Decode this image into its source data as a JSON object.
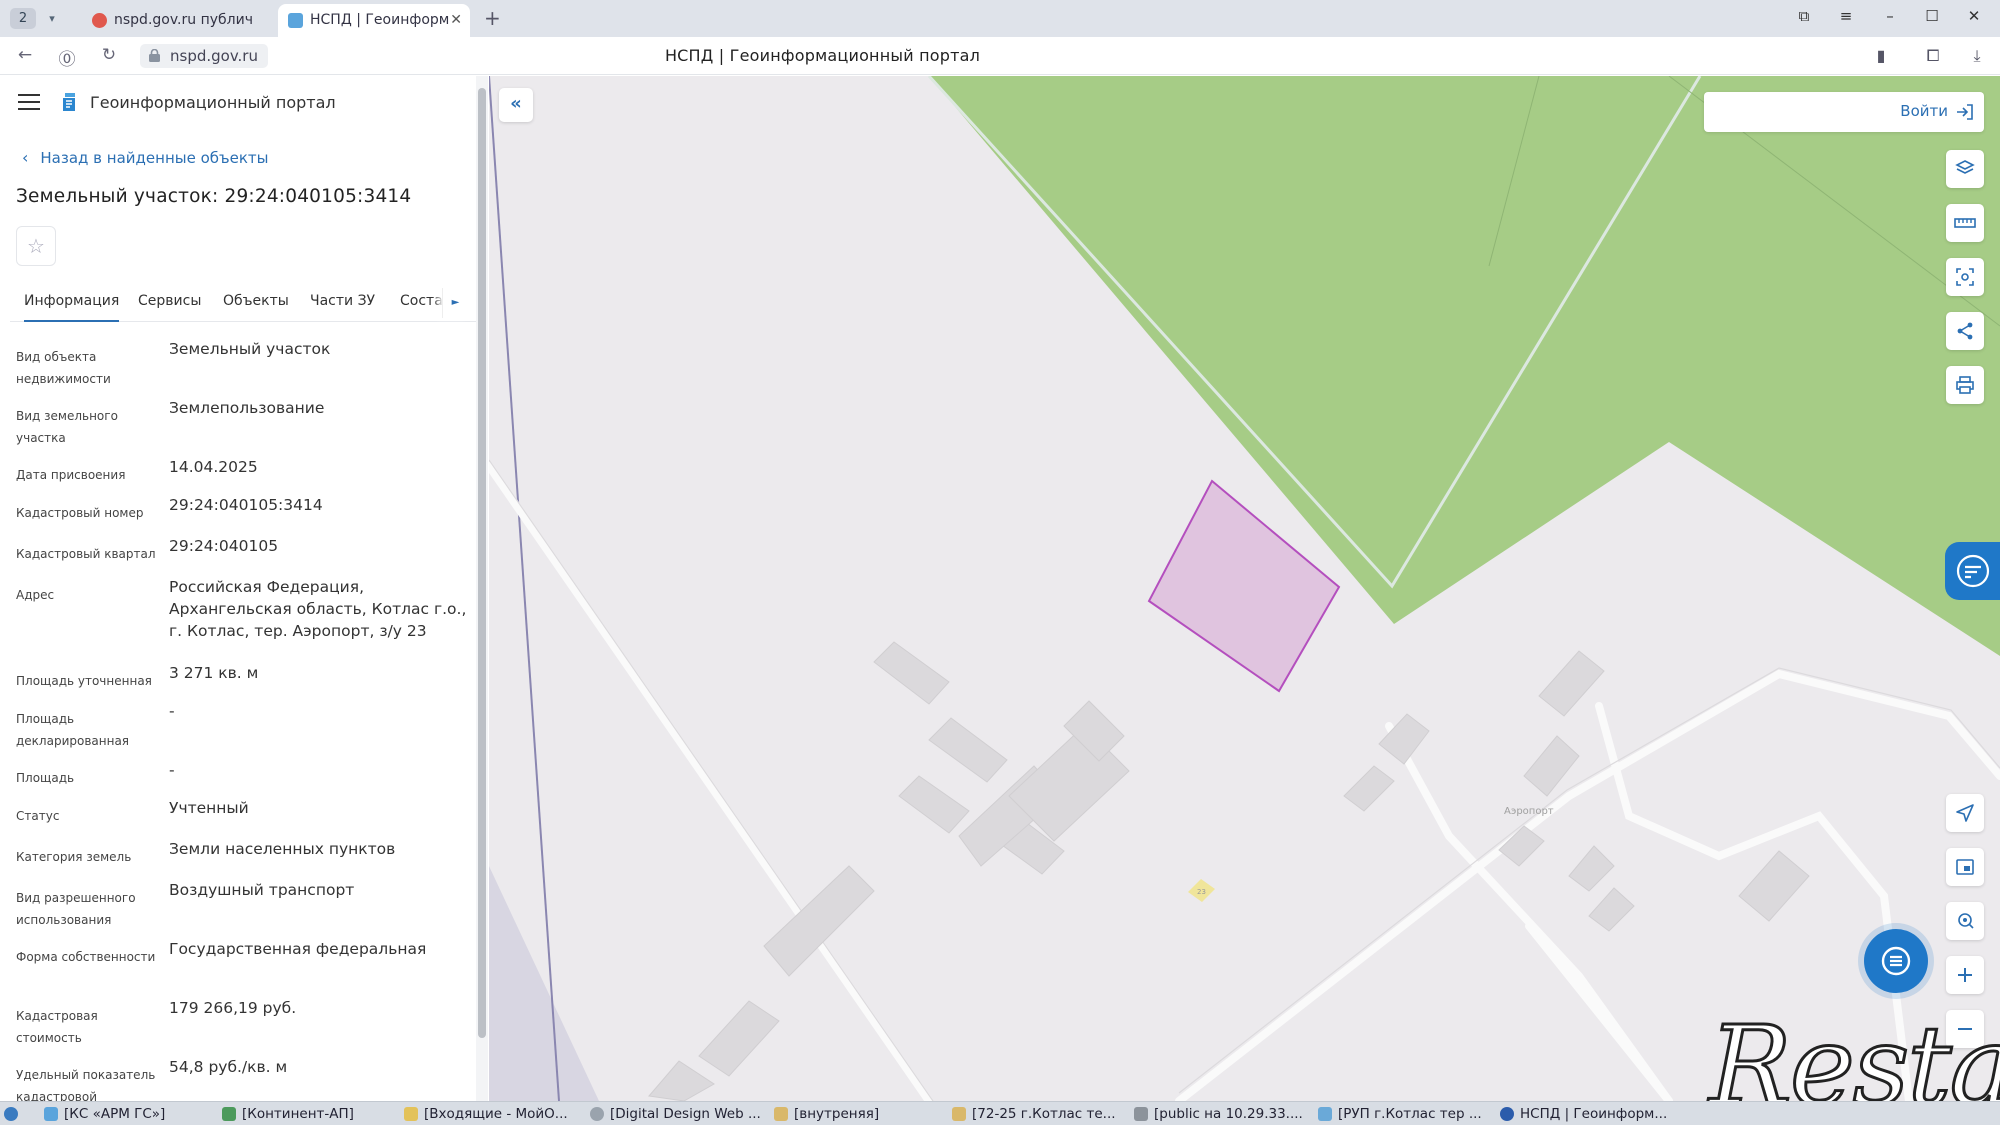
{
  "browser": {
    "tab_count": "2",
    "tabs": [
      {
        "label": "nspd.gov.ru публичная"
      },
      {
        "label": "НСПД | Геоинформа"
      }
    ],
    "url": "nspd.gov.ru",
    "page_title": "НСПД | Геоинформационный портал"
  },
  "panel": {
    "portal_name": "Геоинформационный портал",
    "back_link": "Назад в найденные объекты",
    "title": "Земельный участок: 29:24:040105:3414",
    "tabs": [
      {
        "label": "Информация"
      },
      {
        "label": "Сервисы"
      },
      {
        "label": "Объекты"
      },
      {
        "label": "Части ЗУ"
      },
      {
        "label": "Соста"
      }
    ],
    "rows": [
      {
        "label": "Вид объекта недвижимости",
        "value": "Земельный участок"
      },
      {
        "label": "Вид земельного участка",
        "value": "Землепользование"
      },
      {
        "label": "Дата присвоения",
        "value": "14.04.2025"
      },
      {
        "label": "Кадастровый номер",
        "value": "29:24:040105:3414"
      },
      {
        "label": "Кадастровый квартал",
        "value": "29:24:040105"
      },
      {
        "label": "Адрес",
        "value": "Российская Федерация, Архангельская область, Котлас г.о., г. Котлас, тер. Аэропорт, з/у 23"
      },
      {
        "label": "Площадь уточненная",
        "value": "3 271 кв. м"
      },
      {
        "label": "Площадь декларированная",
        "value": "-"
      },
      {
        "label": "Площадь",
        "value": "-"
      },
      {
        "label": "Статус",
        "value": "Учтенный"
      },
      {
        "label": "Категория земель",
        "value": "Земли населенных пунктов"
      },
      {
        "label": "Вид разрешенного использования",
        "value": "Воздушный транспорт"
      },
      {
        "label": "Форма собственности",
        "value": "Государственная федеральная"
      },
      {
        "label": "Кадастровая стоимость",
        "value": "179 266,19 руб."
      },
      {
        "label": "Удельный показатель кадастровой",
        "value": "54,8 руб./кв. м"
      }
    ]
  },
  "map": {
    "login_label": "Войти",
    "area_label": "Аэропорт",
    "parcel_label": "23",
    "watermark": "Restate",
    "colors": {
      "forest": "#a6cc86",
      "parcel_fill": "#e0c4df",
      "parcel_stroke": "#b44fbe",
      "accent": "#1f78c8"
    }
  },
  "taskbar": {
    "items": [
      {
        "label": "[КС «АРМ ГС»]"
      },
      {
        "label": "[Континент-АП]"
      },
      {
        "label": "[Входящие - МойО..."
      },
      {
        "label": "[Digital Design Web ..."
      },
      {
        "label": "[внутреняя]"
      },
      {
        "label": "[72-25 г.Котлас те..."
      },
      {
        "label": "[public на 10.29.33...."
      },
      {
        "label": "[РУП г.Котлас тер ..."
      },
      {
        "label": "НСПД | Геоинформ..."
      }
    ]
  }
}
